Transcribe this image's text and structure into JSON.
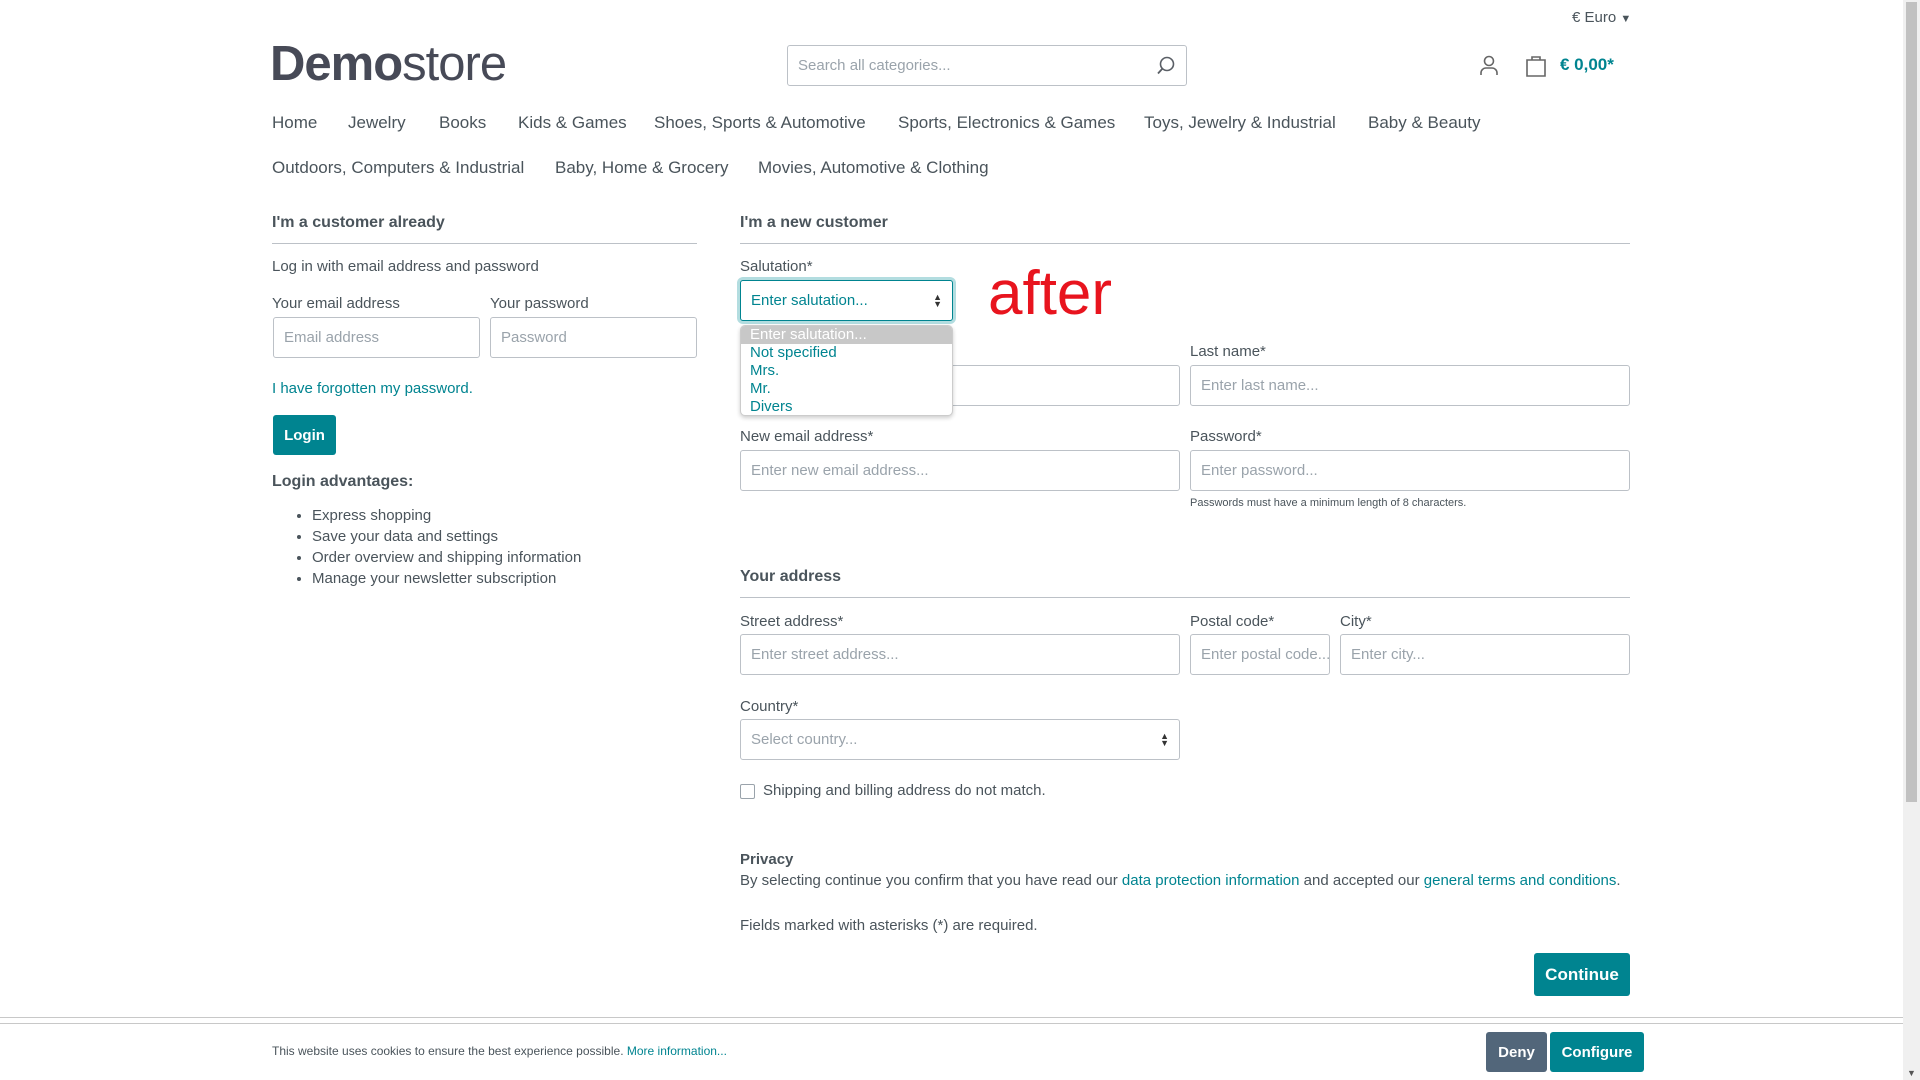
{
  "header": {
    "currency": "€ Euro",
    "logo_bold": "Demo",
    "logo_light": "store",
    "search_placeholder": "Search all categories...",
    "cart_total": "€ 0,00*"
  },
  "nav": [
    "Home",
    "Jewelry",
    "Books",
    "Kids & Games",
    "Shoes, Sports & Automotive",
    "Sports, Electronics & Games",
    "Toys, Jewelry & Industrial",
    "Baby & Beauty",
    "Outdoors, Computers & Industrial",
    "Baby, Home & Grocery",
    "Movies, Automotive & Clothing"
  ],
  "login": {
    "title": "I'm a customer already",
    "intro": "Log in with email address and password",
    "email_label": "Your email address",
    "email_placeholder": "Email address",
    "password_label": "Your password",
    "password_placeholder": "Password",
    "forgot": "I have forgotten my password.",
    "button": "Login",
    "advantages_title": "Login advantages:",
    "advantages": [
      "Express shopping",
      "Save your data and settings",
      "Order overview and shipping information",
      "Manage your newsletter subscription"
    ]
  },
  "register": {
    "title": "I'm a new customer",
    "salutation_label": "Salutation*",
    "salutation_value": "Enter salutation...",
    "salutation_options": [
      "Enter salutation...",
      "Not specified",
      "Mrs.",
      "Mr.",
      "Divers"
    ],
    "annotation": "after",
    "lastname_label": "Last name*",
    "lastname_placeholder": "Enter last name...",
    "email_label": "New email address*",
    "email_placeholder": "Enter new email address...",
    "password_label": "Password*",
    "password_placeholder": "Enter password...",
    "password_hint": "Passwords must have a minimum length of 8 characters.",
    "address_title": "Your address",
    "street_label": "Street address*",
    "street_placeholder": "Enter street address...",
    "postal_label": "Postal code*",
    "postal_placeholder": "Enter postal code...",
    "city_label": "City*",
    "city_placeholder": "Enter city...",
    "country_label": "Country*",
    "country_placeholder": "Select country...",
    "shipping_checkbox": "Shipping and billing address do not match.",
    "privacy_title": "Privacy",
    "privacy_pre": "By selecting continue you confirm that you have read our ",
    "privacy_link1": "data protection information",
    "privacy_mid": " and accepted our ",
    "privacy_link2": "general terms and conditions",
    "privacy_post": ".",
    "required_note": "Fields marked with asterisks (*) are required.",
    "continue": "Continue"
  },
  "cookie": {
    "text": "This website uses cookies to ensure the best experience possible. ",
    "more": "More information...",
    "deny": "Deny",
    "configure": "Configure"
  },
  "colors": {
    "accent": "#008490",
    "deny": "#52667a",
    "annotation": "#e8141e"
  }
}
